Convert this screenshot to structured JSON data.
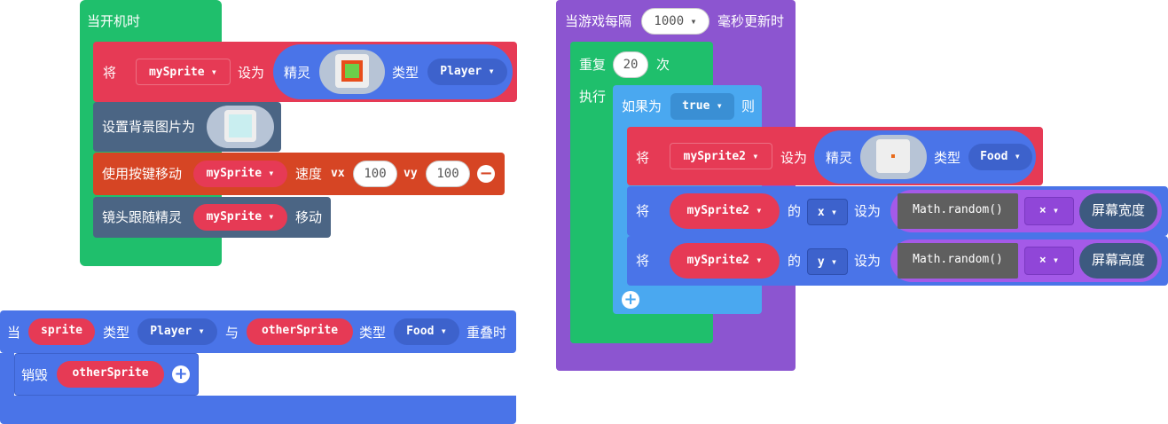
{
  "on_start": {
    "hat": "当开机时",
    "set_sprite": {
      "prefix": "将",
      "var": "mySprite",
      "set_to": "设为",
      "sprite_label": "精灵",
      "type_label": "类型",
      "kind": "Player"
    },
    "background": {
      "label": "设置背景图片为"
    },
    "move": {
      "label": "使用按键移动",
      "var": "mySprite",
      "speed": "速度",
      "vx_label": "vx",
      "vx": "100",
      "vy_label": "vy",
      "vy": "100"
    },
    "camera": {
      "label": "镜头跟随精灵",
      "var": "mySprite",
      "suffix": "移动"
    }
  },
  "overlap": {
    "when": "当",
    "sprite": "sprite",
    "type1": "类型",
    "kind1": "Player",
    "with": "与",
    "other": "otherSprite",
    "type2": "类型",
    "kind2": "Food",
    "overlap": "重叠时",
    "destroy": {
      "label": "销毁",
      "var": "otherSprite"
    }
  },
  "interval": {
    "prefix": "当游戏每隔",
    "ms": "1000",
    "suffix": "毫秒更新时",
    "repeat": {
      "label": "重复",
      "count": "20",
      "times": "次",
      "do": "执行"
    },
    "if": {
      "label": "如果为",
      "cond": "true",
      "then": "则"
    },
    "set_food": {
      "prefix": "将",
      "var": "mySprite2",
      "set_to": "设为",
      "sprite_label": "精灵",
      "type_label": "类型",
      "kind": "Food"
    },
    "set_x": {
      "prefix": "将",
      "var": "mySprite2",
      "of": "的",
      "prop": "x",
      "set_to": "设为",
      "fn": "Math.random()",
      "op": "×",
      "value": "屏幕宽度"
    },
    "set_y": {
      "prefix": "将",
      "var": "mySprite2",
      "of": "的",
      "prop": "y",
      "set_to": "设为",
      "fn": "Math.random()",
      "op": "×",
      "value": "屏幕高度"
    }
  },
  "colors": {
    "loops_green": "#1fbf6c",
    "sprites_red": "#e63a55",
    "sprite_blue": "#4a74e8",
    "scene_slate": "#4b6584",
    "controller_orange": "#d64524",
    "game_purple": "#8c55d0",
    "logic_blue": "#4aa8f0",
    "math_purple": "#a45ae8",
    "info_dark": "#3d5a80"
  }
}
